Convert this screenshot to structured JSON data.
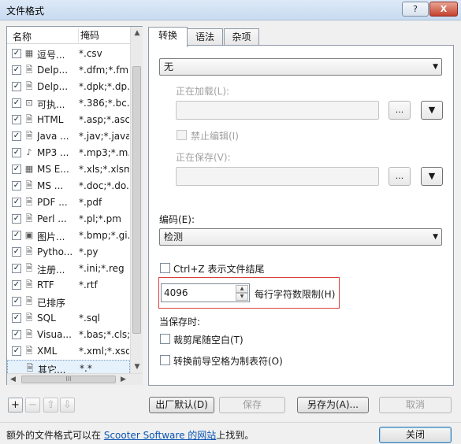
{
  "window": {
    "title": "文件格式",
    "help_label": "?",
    "close_label": "X"
  },
  "list": {
    "col_name": "名称",
    "col_mask": "掩码",
    "rows": [
      {
        "checked": true,
        "icon": "grid-file-icon",
        "name": "逗号...",
        "mask": "*.csv"
      },
      {
        "checked": true,
        "icon": "document-icon",
        "name": "Delp...",
        "mask": "*.dfm;*.fm..."
      },
      {
        "checked": true,
        "icon": "document-icon",
        "name": "Delp...",
        "mask": "*.dpk;*.dp..."
      },
      {
        "checked": true,
        "icon": "binary-file-icon",
        "name": "可执...",
        "mask": "*.386;*.bc..."
      },
      {
        "checked": true,
        "icon": "document-icon",
        "name": "HTML",
        "mask": "*.asp;*.asc..."
      },
      {
        "checked": true,
        "icon": "document-icon",
        "name": "Java ...",
        "mask": "*.jav;*.java"
      },
      {
        "checked": true,
        "icon": "music-file-icon",
        "name": "MP3 ...",
        "mask": "*.mp3;*.m..."
      },
      {
        "checked": true,
        "icon": "grid-file-icon",
        "name": "MS E...",
        "mask": "*.xls;*.xlsm"
      },
      {
        "checked": true,
        "icon": "document-icon",
        "name": "MS ...",
        "mask": "*.doc;*.do..."
      },
      {
        "checked": true,
        "icon": "document-icon",
        "name": "PDF ...",
        "mask": "*.pdf"
      },
      {
        "checked": true,
        "icon": "document-icon",
        "name": "Perl ...",
        "mask": "*.pl;*.pm"
      },
      {
        "checked": true,
        "icon": "image-file-icon",
        "name": "图片...",
        "mask": "*.bmp;*.gi..."
      },
      {
        "checked": true,
        "icon": "document-icon",
        "name": "Pytho...",
        "mask": "*.py"
      },
      {
        "checked": true,
        "icon": "document-icon",
        "name": "注册...",
        "mask": "*.ini;*.reg"
      },
      {
        "checked": true,
        "icon": "document-icon",
        "name": "RTF",
        "mask": "*.rtf"
      },
      {
        "checked": true,
        "icon": "document-icon",
        "name": "已排序",
        "mask": ""
      },
      {
        "checked": true,
        "icon": "document-icon",
        "name": "SQL",
        "mask": "*.sql"
      },
      {
        "checked": true,
        "icon": "document-icon",
        "name": "Visua...",
        "mask": "*.bas;*.cls;..."
      },
      {
        "checked": true,
        "icon": "document-icon",
        "name": "XML",
        "mask": "*.xml;*.xsd"
      },
      {
        "checked": false,
        "icon": "document-icon",
        "name": "其它...",
        "mask": "*.*"
      }
    ]
  },
  "list_buttons": {
    "add": "+",
    "remove": "−",
    "up": "⇧",
    "down": "⇩"
  },
  "tabs": [
    {
      "label": "转换",
      "active": true
    },
    {
      "label": "语法",
      "active": false
    },
    {
      "label": "杂项",
      "active": false
    }
  ],
  "conversion": {
    "type_value": "无",
    "loading_label": "正在加载(L):",
    "disable_edit_label": "禁止编辑(I)",
    "saving_label": "正在保存(V):",
    "browse_label": "...",
    "encoding_label": "编码(E):",
    "encoding_value": "检测",
    "ctrlz_label": "Ctrl+Z 表示文件结尾",
    "line_limit_value": "4096",
    "line_limit_label": "每行字符数限制(H)",
    "on_save_label": "当保存时:",
    "trim_label": "裁剪尾随空白(T)",
    "tabs_label": "转换前导空格为制表符(O)"
  },
  "buttons": {
    "defaults": "出厂默认(D)",
    "save": "保存",
    "save_as": "另存为(A)...",
    "cancel": "取消",
    "close": "关闭"
  },
  "status": {
    "prefix": "额外的文件格式可以在 ",
    "link": "Scooter Software 的网站",
    "suffix": "上找到。"
  }
}
